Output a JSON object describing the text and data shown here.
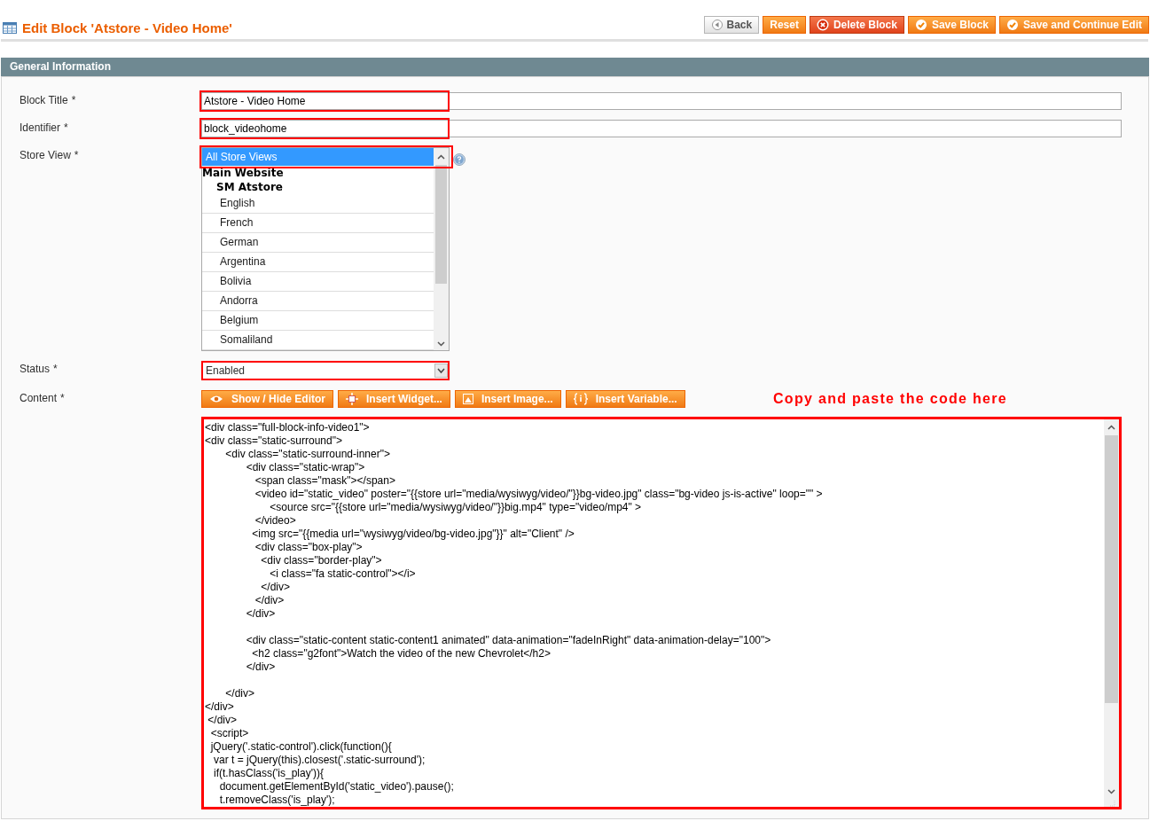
{
  "header": {
    "title": "Edit Block 'Atstore - Video Home'",
    "buttons": [
      {
        "label": "Back",
        "kind": "back"
      },
      {
        "label": "Reset",
        "kind": "reset"
      },
      {
        "label": "Delete Block",
        "kind": "delete"
      },
      {
        "label": "Save Block",
        "kind": "save"
      },
      {
        "label": "Save and Continue Edit",
        "kind": "save"
      }
    ]
  },
  "section": {
    "title": "General Information"
  },
  "fields": [
    {
      "label": "Block Title",
      "required_mark": "*",
      "kind": "text",
      "value": "Atstore - Video Home",
      "highlighted": true
    },
    {
      "label": "Identifier",
      "required_mark": "*",
      "kind": "text",
      "value": "block_videohome",
      "highlighted": true
    },
    {
      "label": "Store View",
      "required_mark": "*",
      "kind": "multiselect",
      "highlighted": true,
      "options": [
        {
          "label": "All Store Views",
          "kind": "option",
          "selected": true
        },
        {
          "label": "Main Website",
          "kind": "website",
          "children": [
            {
              "label": "SM Atstore",
              "kind": "store",
              "children": [
                {
                  "label": "English",
                  "kind": "option",
                  "selected": false
                },
                {
                  "label": "French",
                  "kind": "option",
                  "selected": false
                },
                {
                  "label": "German",
                  "kind": "option",
                  "selected": false
                },
                {
                  "label": "Argentina",
                  "kind": "option",
                  "selected": false
                },
                {
                  "label": "Bolivia",
                  "kind": "option",
                  "selected": false
                },
                {
                  "label": "Andorra",
                  "kind": "option",
                  "selected": false
                },
                {
                  "label": "Belgium",
                  "kind": "option",
                  "selected": false
                },
                {
                  "label": "Somaliland",
                  "kind": "option",
                  "selected": false
                }
              ]
            }
          ]
        }
      ]
    },
    {
      "label": "Status",
      "required_mark": "*",
      "kind": "select",
      "value": "Enabled",
      "highlighted": true
    },
    {
      "label": "Content",
      "required_mark": "*",
      "kind": "editor",
      "highlighted": true,
      "toolbar": [
        {
          "label": "Show / Hide Editor",
          "kind": "eye"
        },
        {
          "label": "Insert Widget...",
          "kind": "widget"
        },
        {
          "label": "Insert Image...",
          "kind": "image"
        },
        {
          "label": "Insert Variable...",
          "kind": "variable"
        }
      ],
      "note": "Copy and paste the code here",
      "value": "<div class=\"full-block-info-video1\">\n<div class=\"static-surround\">\n       <div class=\"static-surround-inner\">\n              <div class=\"static-wrap\">\n                 <span class=\"mask\"></span>\n                 <video id=\"static_video\" poster=\"{{store url=\"media/wysiwyg/video/\"}}bg-video.jpg\" class=\"bg-video js-is-active\" loop=\"\" >\n                      <source src=\"{{store url=\"media/wysiwyg/video/\"}}big.mp4\" type=\"video/mp4\" >\n                 </video>\n                <img src=\"{{media url=\"wysiwyg/video/bg-video.jpg\"}}\" alt=\"Client\" />\n                 <div class=\"box-play\">\n                   <div class=\"border-play\">\n                      <i class=\"fa static-control\"></i>\n                   </div>\n                 </div>\n              </div>\n\n              <div class=\"static-content static-content1 animated\" data-animation=\"fadeInRight\" data-animation-delay=\"100\">\n                <h2 class=\"g2font\">Watch the video of the new Chevrolet</h2>\n              </div>\n\n       </div>\n</div>\n </div>\n  <script>\n  jQuery('.static-control').click(function(){\n   var t = jQuery(this).closest('.static-surround');\n   if(t.hasClass('is_play')){\n     document.getElementById('static_video').pause();\n     t.removeClass('is_play');"
    }
  ]
}
